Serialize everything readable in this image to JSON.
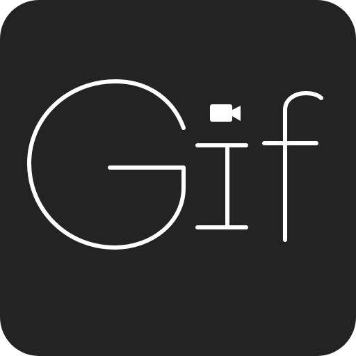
{
  "icon": {
    "wordmark": "Gif",
    "background_color": "#232323",
    "foreground_color": "#ffffff",
    "accent_icon": "video-camera-icon"
  }
}
